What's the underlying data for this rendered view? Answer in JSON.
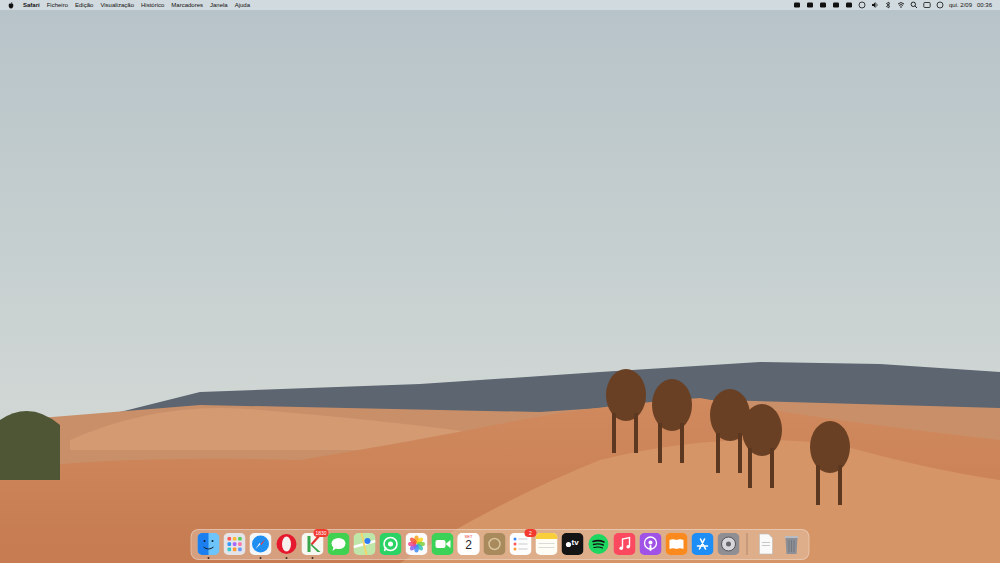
{
  "menu_bar": {
    "app": "Safari",
    "items": [
      "Ficheiro",
      "Edição",
      "Visualização",
      "Histórico",
      "Marcadores",
      "Janela",
      "Ajuda"
    ],
    "date": "qui. 2/09",
    "time": "00:36"
  },
  "dock": {
    "apps": [
      {
        "kind": "finder",
        "running": true,
        "badge": ""
      },
      {
        "kind": "launchpad",
        "running": false,
        "badge": ""
      },
      {
        "kind": "safari",
        "running": true,
        "badge": ""
      },
      {
        "kind": "opera",
        "running": true,
        "badge": ""
      },
      {
        "kind": "kapp",
        "running": true,
        "badge": "1830"
      },
      {
        "kind": "messages",
        "running": false,
        "badge": ""
      },
      {
        "kind": "maps",
        "running": false,
        "badge": ""
      },
      {
        "kind": "whatsapp",
        "running": false,
        "badge": ""
      },
      {
        "kind": "photos",
        "running": false,
        "badge": ""
      },
      {
        "kind": "facetime",
        "running": false,
        "badge": ""
      },
      {
        "kind": "calendar",
        "running": false,
        "badge": "",
        "month": "SET",
        "day": "2"
      },
      {
        "kind": "brownapp",
        "running": false,
        "badge": ""
      },
      {
        "kind": "reminders",
        "running": false,
        "badge": "2"
      },
      {
        "kind": "notes",
        "running": false,
        "badge": ""
      },
      {
        "kind": "tv",
        "running": false,
        "badge": "",
        "label": "tv"
      },
      {
        "kind": "spotify",
        "running": false,
        "badge": ""
      },
      {
        "kind": "music",
        "running": false,
        "badge": ""
      },
      {
        "kind": "podcasts",
        "running": false,
        "badge": ""
      },
      {
        "kind": "books",
        "running": false,
        "badge": ""
      },
      {
        "kind": "appstore",
        "running": false,
        "badge": ""
      },
      {
        "kind": "settings",
        "running": false,
        "badge": ""
      }
    ],
    "others": [
      {
        "kind": "document",
        "running": false,
        "badge": ""
      },
      {
        "kind": "trash",
        "running": false,
        "badge": ""
      }
    ]
  }
}
